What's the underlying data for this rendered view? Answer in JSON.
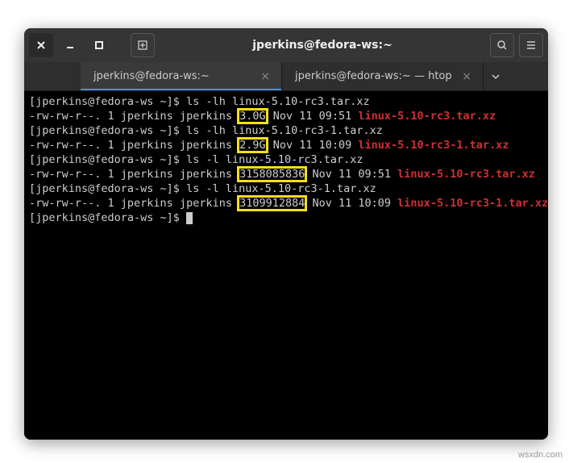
{
  "window": {
    "title": "jperkins@fedora-ws:~"
  },
  "tabs": [
    {
      "label": "jperkins@fedora-ws:~",
      "active": true
    },
    {
      "label": "jperkins@fedora-ws:~ — htop",
      "active": false
    }
  ],
  "prompt": "[jperkins@fedora-ws ~]$ ",
  "lines": [
    {
      "cmd": "ls -lh linux-5.10-rc3.tar.xz"
    },
    {
      "perm": "-rw-rw-r--. 1 jperkins jperkins ",
      "size": "3.0G",
      "mid": " Nov 11 09:51 ",
      "file": "linux-5.10-rc3.tar.xz"
    },
    {
      "cmd": "ls -lh linux-5.10-rc3-1.tar.xz"
    },
    {
      "perm": "-rw-rw-r--. 1 jperkins jperkins ",
      "size": "2.9G",
      "mid": " Nov 11 10:09 ",
      "file": "linux-5.10-rc3-1.tar.xz"
    },
    {
      "cmd": "ls -l linux-5.10-rc3.tar.xz"
    },
    {
      "perm": "-rw-rw-r--. 1 jperkins jperkins ",
      "size": "3158085836",
      "mid": " Nov 11 09:51 ",
      "file": "linux-5.10-rc3.tar.xz"
    },
    {
      "cmd": "ls -l linux-5.10-rc3-1.tar.xz"
    },
    {
      "perm": "-rw-rw-r--. 1 jperkins jperkins ",
      "size": "3109912884",
      "mid": " Nov 11 10:09 ",
      "file": "linux-5.10-rc3-1.tar.xz"
    }
  ],
  "watermark": "wsxdn.com"
}
